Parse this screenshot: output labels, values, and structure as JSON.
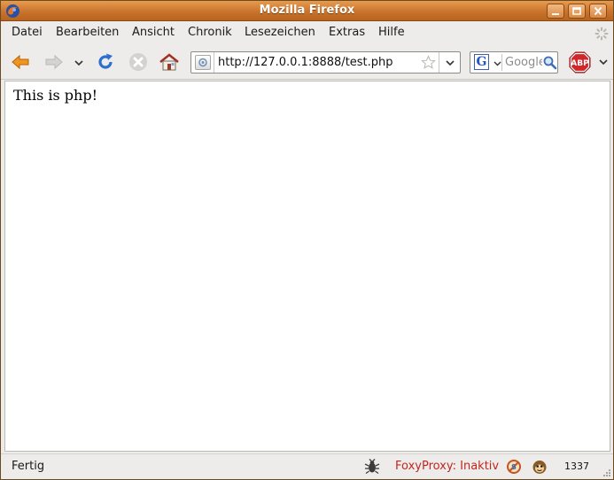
{
  "window": {
    "title": "Mozilla Firefox",
    "app_icon": "firefox-icon",
    "controls": [
      "minimize-icon",
      "maximize-icon",
      "close-icon"
    ]
  },
  "menubar": {
    "items": [
      {
        "label": "Datei"
      },
      {
        "label": "Bearbeiten"
      },
      {
        "label": "Ansicht"
      },
      {
        "label": "Chronik"
      },
      {
        "label": "Lesezeichen"
      },
      {
        "label": "Extras"
      },
      {
        "label": "Hilfe"
      }
    ],
    "throbber_icon": "throbber-icon"
  },
  "navbar": {
    "buttons": [
      {
        "name": "back",
        "icon": "back-arrow-icon"
      },
      {
        "name": "forward",
        "icon": "forward-arrow-icon",
        "disabled": true
      },
      {
        "name": "history-dropdown",
        "icon": "chevron-down-icon"
      },
      {
        "name": "reload",
        "icon": "reload-icon"
      },
      {
        "name": "stop",
        "icon": "stop-icon",
        "disabled": true
      },
      {
        "name": "home",
        "icon": "home-icon"
      }
    ],
    "url": {
      "value": "http://127.0.0.1:8888/test.php",
      "site_icon": "page-icon",
      "bookmark_icon": "star-icon",
      "dropdown_icon": "chevron-down-icon"
    },
    "search": {
      "engine_letter": "G",
      "placeholder": "Google",
      "search_icon": "magnifier-icon"
    },
    "addon": {
      "label": "ABP",
      "icon": "adblock-plus-icon"
    }
  },
  "content": {
    "text": "This is php!"
  },
  "statusbar": {
    "status": "Fertig",
    "foxyproxy": "FoxyProxy: Inaktiv",
    "counter": "1337",
    "icons": [
      "firebug-icon",
      "noscript-icon",
      "greasemonkey-icon",
      "resize-grip-icon"
    ]
  },
  "colors": {
    "titlebar": "#c9742c",
    "foxyproxy_text": "#c0281e",
    "abp_red": "#d1262a",
    "chrome_bg": "#edeceb"
  }
}
